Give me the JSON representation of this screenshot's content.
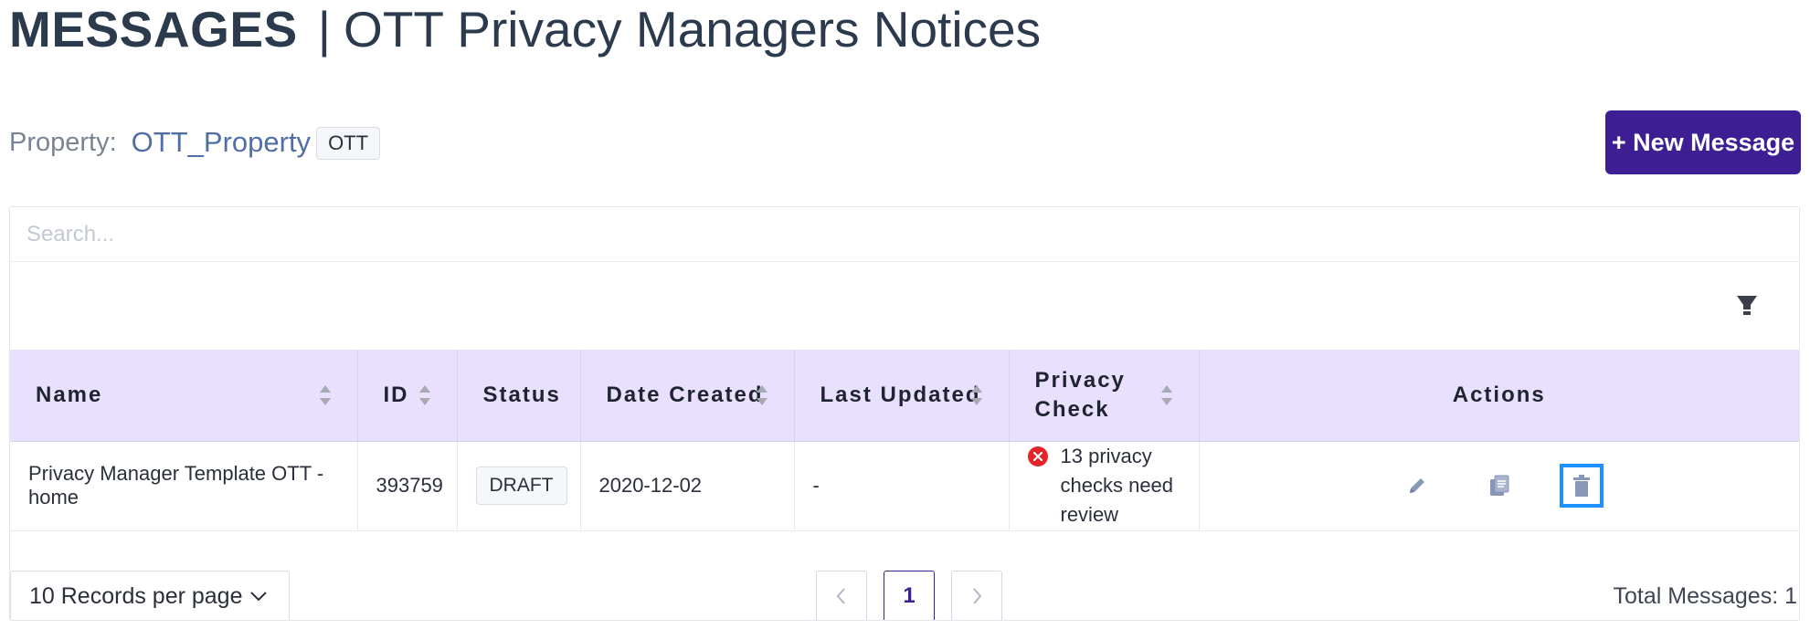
{
  "header": {
    "title_strong": "MESSAGES",
    "separator": "|",
    "title_sub": "OTT Privacy Managers Notices"
  },
  "property": {
    "label": "Property:",
    "name": "OTT_Property",
    "tag": "OTT"
  },
  "new_message_button": "+ New Message",
  "search": {
    "placeholder": "Search..."
  },
  "table": {
    "columns": {
      "name": "Name",
      "id": "ID",
      "status": "Status",
      "date_created": "Date Created",
      "last_updated": "Last Updated",
      "privacy_check": "Privacy Check",
      "actions": "Actions"
    },
    "rows": [
      {
        "name": "Privacy Manager Template OTT - home",
        "id": "393759",
        "status": "DRAFT",
        "date_created": "2020-12-02",
        "last_updated": "-",
        "privacy_check": "13 privacy checks need review"
      }
    ]
  },
  "pagination": {
    "records_per_page": "10 Records per page",
    "current_page": "1",
    "total_messages": "Total Messages: 1"
  },
  "colors": {
    "accent": "#3d1f93",
    "header_bg": "#e8e0fd",
    "error": "#e5252a",
    "selection": "#1e90ff"
  },
  "icons": [
    "filter-icon",
    "sort-icon",
    "error-icon",
    "edit-icon",
    "copy-icon",
    "delete-icon",
    "chevron-down-icon",
    "chevron-left-icon",
    "chevron-right-icon"
  ]
}
